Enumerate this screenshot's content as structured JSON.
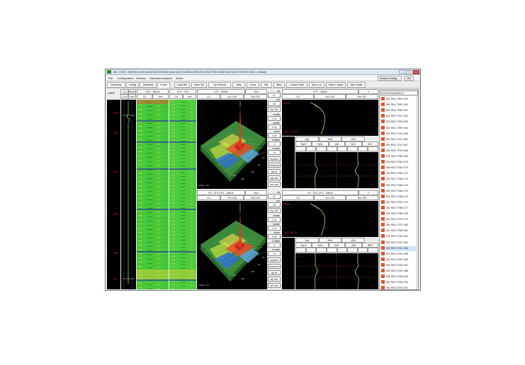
{
  "window": {
    "title": "M8 - C003 - C4B Rev3 with bob (DS8 X0-M inlet mush ctrl) 1CCSDAL00001 001 R012 R01K 0364 (Tue Nov 5 14:49:03 2013 - primary)",
    "min_label": "–",
    "max_label": "□",
    "close_label": "×"
  },
  "menu": {
    "items": [
      "File",
      "Configuration",
      "Window",
      "Standard Analysis",
      "About"
    ],
    "restore_config": "Restore Config",
    "on_label": "ON"
  },
  "toolbar": {
    "tabs": [
      "Summary",
      "Config",
      "Standard",
      "CScan"
    ],
    "buttons": [
      "Load Sel",
      "Save Sel",
      "Op Selects",
      "Volts",
      "Curve",
      "Mix",
      "Slew",
      "L-Mark Table",
      "Auto Loc",
      "Store L-Mark",
      "Man Scale"
    ]
  },
  "strip": {
    "lmrk": "LMRK",
    "ch_a": "C8",
    "freq_a": "30kHz",
    "ch_b": "C16",
    "mode_b": "Vert",
    "cscan1_title": "CF2 : 30kHz",
    "cscan1_c": "C4",
    "cscan1_v": "Vert",
    "cscan2_title": "CF2 : CF4",
    "cscan2_c": "C4",
    "cscan2_v": "Vert",
    "marks": [
      "TSH",
      "020",
      "040",
      "060",
      "080",
      "TS"
    ]
  },
  "iso": [
    {
      "title": "CF2 : 30kHz",
      "mode": "Vert",
      "c": "C4",
      "vd": "v/d 2.80",
      "rot": "Rot 187",
      "filters": "Filters: Yet",
      "axes": [
        "100",
        "200",
        "270",
        "60",
        "40"
      ],
      "ctrl": {
        "rot_lbl": "rot",
        "rot": "57",
        "pol_lbl": "pol",
        "pol": "43",
        "flip": "flip 180",
        "xscale_lbl": "xscale",
        "xscale": "1.14",
        "yscale_lbl": "yscale",
        "yscale": "1.14",
        "zoom_lbl": "zoom",
        "zoom": "1.00",
        "hoffset_lbl": "h offset",
        "hoffset": "-0",
        "vscale_lbl": "# scale",
        "vscale": "7x",
        "topview": "topview",
        "threshold": "threshold",
        "adj_fill": "adj fill",
        "adj_rise": "adj rise",
        "sel_rots": "sel rots"
      }
    },
    {
      "title": "P2 : CF2-CF4 : 30kHz",
      "mode": "Vert",
      "c": "C4",
      "vd": "v/d 2.80",
      "rot": "Rot 194",
      "filters": "Filters: Yet",
      "axes": [
        "100",
        "200",
        "270",
        "60",
        "40"
      ],
      "ctrl": {
        "rot_lbl": "rot",
        "rot": "57",
        "pol_lbl": "pol",
        "pol": "43",
        "flip": "flip 180",
        "xscale_lbl": "xscale",
        "xscale": "1.14",
        "yscale_lbl": "yscale",
        "yscale": "1.14",
        "zoom_lbl": "zoom",
        "zoom": "1.00",
        "hoffset_lbl": "h offset",
        "hoffset": "-0",
        "vscale_lbl": "# scale",
        "vscale": "7x",
        "topview": "topview",
        "threshold": "threshold",
        "adj_fill": "adj fill",
        "adj_rise": "adj rise",
        "sel_rots": "sel rots"
      }
    }
  ],
  "lissa": [
    {
      "title": "CF2 : 30kHz",
      "axis": "Y",
      "c": "C4",
      "vd": "v/d 2.83",
      "rot": "Rot 187",
      "red_top": "0030",
      "red_bottom": "167 • 10.83",
      "buttons": [
        "Vpp",
        "MxR",
        "VMx"
      ],
      "buttons2": [
        "Rpt E",
        "NDD",
        "ADI",
        "BLG",
        "DNT"
      ],
      "strip_label": "– +",
      "strip_tail": "– -0"
    },
    {
      "title": "P2 : CF2-CF4 : 30kHz",
      "axis": "Y",
      "c": "C4",
      "vd": "v/d 2.83",
      "rot": "Rot 194",
      "red_top": "0030",
      "red_bottom": "167 • 10.83",
      "buttons": [
        "Vpp",
        "MxR",
        "VMx"
      ],
      "buttons2": [
        "Rpt E",
        "NDD",
        "DNT",
        "OBS",
        "RBD"
      ],
      "strip_label": "– +",
      "strip_tail": "– -0"
    }
  ],
  "list": {
    "selector": "e/LOKSCAL00001 ▾",
    "rows": [
      "001 R011 T004 I159",
      "001 R011 T005 I160",
      "001 R011 T006 I161",
      "001 R011 T007 I162",
      "001 R011 T008 I163",
      "001 R011 T009 I164",
      "001 R011 T010 I165",
      "001 R011 T011 I166",
      "001 R011 T012 I167",
      "001 R011 T013 I168",
      "001 R012 T060 I169",
      "001 R012 T061 I170",
      "006 R012 T061 I170",
      "001 R012 T062 I171",
      "001 R012 T063 I172",
      "001 R012 T064 I173",
      "001 R012 T065 I174",
      "001 R012 T066 I175",
      "001 R012 T067 I176",
      "001 R012 T068 I177",
      "001 R012 T069 I178",
      "001 R012 T070 I179",
      "001 R012 T071 I180",
      "001 R012 T008 I181",
      "001 R012 T010 I182",
      "001 R012 T011 I183",
      "001 R012 T012 I184",
      "001 R013 T001 I185",
      "001 R013 T002 I186",
      "001 R013 T003 I187",
      "001 R013 T004 I188",
      "001 R013 T005 I189",
      "001 R013 T006 I190",
      "001 R013 T007 I191"
    ],
    "highlighted_index": 26
  },
  "colors": {
    "accent": "#e2562a",
    "red_label": "#e8291b",
    "plot_bg": "#000000",
    "cscan_green": "#49d13a",
    "trace_green": "#6cd45e"
  }
}
